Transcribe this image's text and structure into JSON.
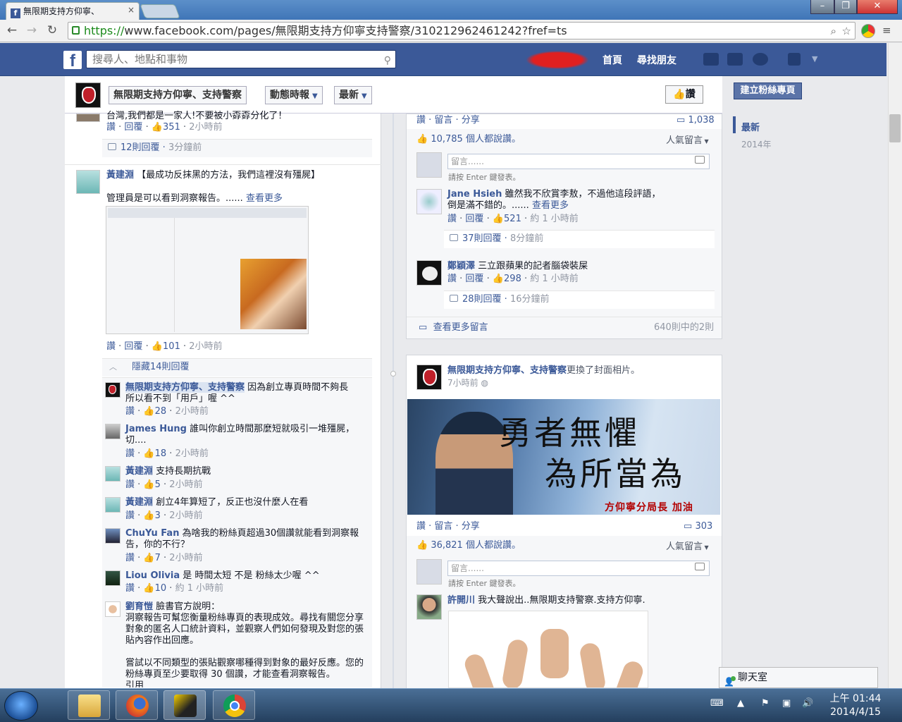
{
  "browser": {
    "tab_title": "無限期支持方仰寧、",
    "url_https": "https://",
    "url_rest": "www.facebook.com/pages/無限期支持方仰寧支持警察/310212962461242?fref=ts"
  },
  "fb": {
    "search_placeholder": "搜尋人、地點和事物",
    "nav_home": "首頁",
    "nav_find": "尋找朋友"
  },
  "page": {
    "name": "無限期支持方仰寧、支持警察",
    "filter1": "動態時報",
    "filter2": "最新",
    "like": "讚",
    "create": "建立粉絲專頁"
  },
  "years": {
    "latest": "最新",
    "y2014": "2014年"
  },
  "left": {
    "top_text": "台灣,我們都是一家人!不要被小孬孬分化了！",
    "top_meta": {
      "like": "讚",
      "reply": "回覆",
      "count": "351",
      "time": "2小時前"
    },
    "top_replies": {
      "text": "12則回覆",
      "time": "3分鐘前"
    },
    "c1": {
      "name": "黃建淵",
      "text": "【最成功反抹黑的方法，我們這裡沒有殭屍】",
      "text2": "管理員是可以看到洞察報告。......",
      "more": "查看更多",
      "like": "讚",
      "reply": "回覆",
      "count": "101",
      "time": "2小時前"
    },
    "hide": "隱藏14則回覆",
    "replies": [
      {
        "name": "無限期支持方仰寧、支持警察",
        "text": "因為創立專頁時間不夠長",
        "text2": "所以看不到「用戶」喔 ^^",
        "like": "讚",
        "count": "28",
        "time": "2小時前"
      },
      {
        "name": "James Hung",
        "text": "誰叫你創立時間那麼短就吸引一堆殭屍，",
        "text2": "切....",
        "like": "讚",
        "count": "18",
        "time": "2小時前"
      },
      {
        "name": "黃建淵",
        "text": "支持長期抗戰",
        "like": "讚",
        "count": "5",
        "time": "2小時前"
      },
      {
        "name": "黃建淵",
        "text": "創立4年算短了，反正也沒什麼人在看",
        "like": "讚",
        "count": "3",
        "time": "2小時前"
      },
      {
        "name": "ChuYu Fan",
        "text": "為啥我的粉絲頁超過30個讚就能看到洞察報",
        "text2": "告，你的不行？",
        "like": "讚",
        "count": "7",
        "time": "2小時前"
      },
      {
        "name": "Liou Olivia",
        "text": "是 時間太短 不是 粉絲太少喔 ^^",
        "like": "讚",
        "count": "10",
        "time": "約 1 小時前"
      },
      {
        "name": "劉育愷",
        "text": "臉書官方說明：",
        "l2": "洞察報告可幫您衡量粉絲專頁的表現成效。尋找有關您分享",
        "l3": "對象的匿名人口統計資料，並觀察人們如何發現及對您的張",
        "l4": "貼內容作出回應。",
        "l5": "嘗試以不同類型的張貼觀察哪種得到對象的最好反應。您的",
        "l6": "粉絲專頁至少要取得 30 個讚，才能查看洞察報告。",
        "l7": "引用"
      }
    ]
  },
  "right": {
    "post1": {
      "actions": "讚 · 留言 · 分享",
      "comments": "1,038",
      "likes": "10,785 個人都說讚。",
      "top": "人氣留言",
      "placeholder": "留言......",
      "hint": "請按 Enter 鍵發表。",
      "c1": {
        "name": "Jane Hsieh",
        "text": "雖然我不欣賞李敖，不過他這段評語，",
        "text2": "倒是滿不錯的。......",
        "more": "查看更多",
        "like": "讚",
        "reply": "回覆",
        "count": "521",
        "time": "約 1 小時前",
        "replies": "37則回覆",
        "rtime": "8分鐘前"
      },
      "c2": {
        "name": "鄭穎澤",
        "text": "三立跟蘋果的記者腦袋裝屎",
        "like": "讚",
        "reply": "回覆",
        "count": "298",
        "time": "約 1 小時前",
        "replies": "28則回覆",
        "rtime": "16分鐘前"
      },
      "more": "查看更多留言",
      "total": "640則中的2則"
    },
    "post2": {
      "name": "無限期支持方仰寧、支持警察",
      "action": "更換了封面相片。",
      "time": "7小時前",
      "cover1": "勇者無懼",
      "cover2": "為所當為",
      "cover3": "方仰寧分局長 加油",
      "actions": "讚 · 留言 · 分享",
      "comments": "303",
      "likes": "36,821 個人都說讚。",
      "top": "人氣留言",
      "placeholder": "留言......",
      "hint": "請按 Enter 鍵發表。",
      "c1": {
        "name": "許開川",
        "text": "我大聲說出..無限期支持警察.支持方仰寧."
      }
    }
  },
  "chat": {
    "label": "聊天室"
  },
  "clock": {
    "time": "上午 01:44",
    "date": "2014/4/15"
  }
}
